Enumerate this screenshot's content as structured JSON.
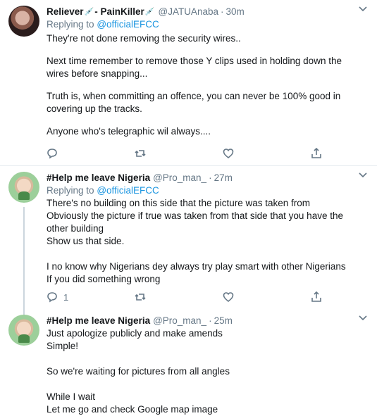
{
  "tweets": [
    {
      "name": "Reliever",
      "name_suffix": "- PainKiller",
      "handle": "@JATUAnaba",
      "time": "30m",
      "replying_prefix": "Replying to",
      "replying_to": "@officialEFCC",
      "paragraphs": [
        "They're not done removing the security wires..",
        "Next time remember to remove those Y clips used in holding down the wires before snapping...",
        "Truth is, when committing an offence, you can never be 100% good in covering up the tracks.",
        "Anyone who's telegraphic wil always...."
      ],
      "reply_count": "",
      "retweet_count": "",
      "like_count": ""
    },
    {
      "name": "#Help me leave Nigeria",
      "handle": "@Pro_man_",
      "time": "27m",
      "replying_prefix": "Replying to",
      "replying_to": "@officialEFCC",
      "paragraphs": [
        "There's no building on this side that the picture was taken from",
        "Obviously the picture if true was taken from that side that you have the other building",
        "Show us that side.",
        "",
        "I no know why Nigerians dey always try play smart with other Nigerians",
        "If you did something wrong"
      ],
      "reply_count": "1",
      "retweet_count": "",
      "like_count": ""
    },
    {
      "name": "#Help me leave Nigeria",
      "handle": "@Pro_man_",
      "time": "25m",
      "paragraphs": [
        "Just apologize publicly and make amends",
        "Simple!",
        "",
        "So we're waiting for pictures from all angles",
        "",
        "While I wait",
        "Let me go and check Google map image"
      ]
    }
  ],
  "dot_separator": "·",
  "icons": {
    "reply": "reply-icon",
    "retweet": "retweet-icon",
    "like": "heart-icon",
    "share": "share-icon",
    "more": "chevron-down-icon",
    "emoji": "syringe-emoji"
  },
  "colors": {
    "link": "#1b95e0",
    "muted": "#657786",
    "text": "#14171a",
    "divider": "#e6ecf0"
  }
}
